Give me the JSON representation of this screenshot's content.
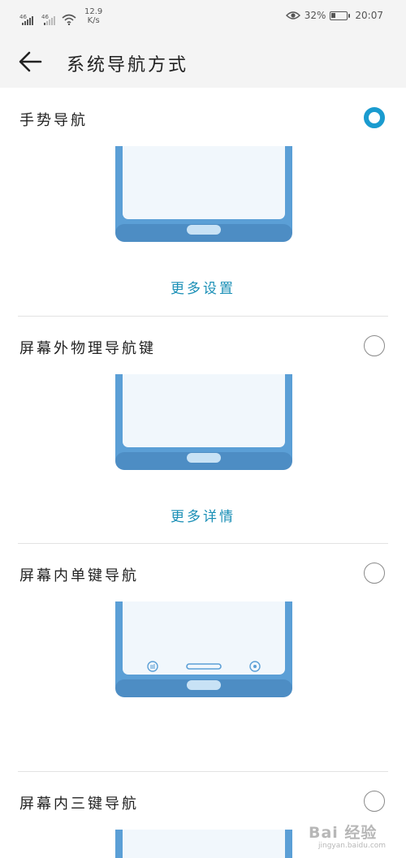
{
  "status_bar": {
    "sim1_tag": "46",
    "sim2_tag": "46",
    "net_speed_value": "12.9",
    "net_speed_unit": "K/s",
    "battery_percent": "32%",
    "battery_level": 0.32,
    "time": "20:07"
  },
  "header": {
    "back_icon": "arrow-left-icon",
    "title": "系统导航方式"
  },
  "options": [
    {
      "label": "手势导航",
      "selected": true,
      "link": "更多设置",
      "illustration": "gesture-bar"
    },
    {
      "label": "屏幕外物理导航键",
      "selected": false,
      "link": "更多详情",
      "illustration": "physical-key"
    },
    {
      "label": "屏幕内单键导航",
      "selected": false,
      "link": "",
      "illustration": "single-key-with-side-icons"
    },
    {
      "label": "屏幕内三键导航",
      "selected": false,
      "link": "",
      "illustration": "three-key"
    }
  ],
  "colors": {
    "accent": "#1a9bcf",
    "link": "#1a8fb6",
    "phone_frame": "#5b9fd6",
    "phone_screen": "#f1f7fc",
    "phone_button": "#c8e2f5"
  },
  "watermark": {
    "text": "Bai 经验",
    "url": "jingyan.baidu.com"
  }
}
